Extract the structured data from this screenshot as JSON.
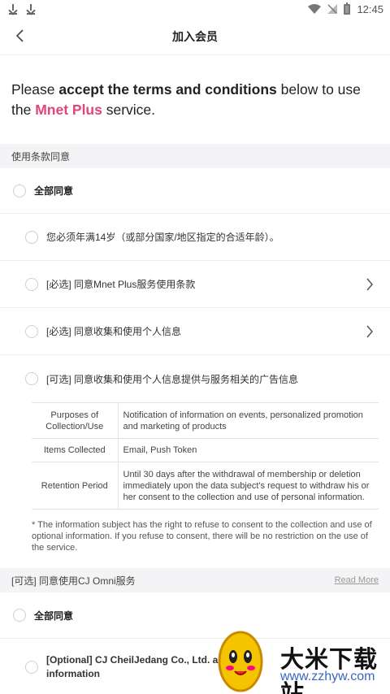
{
  "status_bar": {
    "time": "12:45"
  },
  "header": {
    "title": "加入会员"
  },
  "intro": {
    "part1": "Please ",
    "part2": "accept the terms and conditions",
    "part3": " below to use the ",
    "brand": "Mnet Plus",
    "part4": " service."
  },
  "section1": {
    "title": "使用条款同意",
    "agree_all": "全部同意",
    "items": [
      {
        "label": "您必须年满14岁（或部分国家/地区指定的合适年龄）。"
      },
      {
        "label": "[必选] 同意Mnet Plus服务使用条款"
      },
      {
        "label": "[必选] 同意收集和使用个人信息"
      },
      {
        "label": "[可选] 同意收集和使用个人信息提供与服务相关的广告信息"
      }
    ],
    "table": {
      "purposes_key": "Purposes of Collection/Use",
      "purposes_val": "Notification of information on events, personalized promotion and marketing of products",
      "items_key": "Items Collected",
      "items_val": "Email, Push Token",
      "retention_key": "Retention Period",
      "retention_val": "Until 30 days after the withdrawal of membership or deletion immediately upon the data subject's request to withdraw his or her consent to the collection and use of personal information."
    },
    "note": "* The information subject has the right to refuse to consent to the collection and use of optional information. If you refuse to consent, there will be no restriction on the use of the service."
  },
  "section2": {
    "title": "[可选] 同意使用CJ Omni服务",
    "read_more": "Read More",
    "agree_all": "全部同意",
    "item_label": "[Optional] CJ CheilJedang Co., Ltd. agr... information"
  },
  "watermark": {
    "cn": "大米下载站",
    "url": "www.zzhyw.com"
  },
  "colors": {
    "brand": "#e0457b",
    "section_bg": "#f4f4f6"
  }
}
